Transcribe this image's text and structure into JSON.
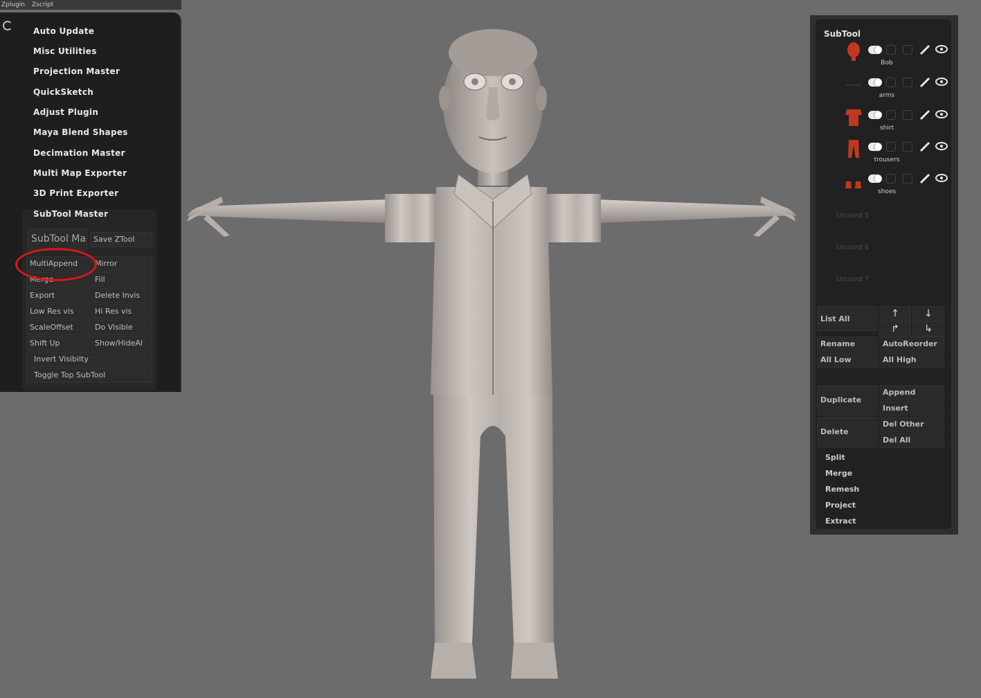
{
  "top_menu": [
    "Zplugin",
    "Zscript"
  ],
  "left_panel": {
    "plugins": [
      "Auto Update",
      "Misc Utilities",
      "Projection Master",
      "QuickSketch",
      "Adjust Plugin",
      "Maya Blend Shapes",
      "Decimation Master",
      "Multi Map Exporter",
      "3D Print Exporter",
      "SubTool Master"
    ],
    "subtool_master": {
      "header": "SubTool Master",
      "save_ztool": "Save ZTool",
      "multiappend": "MultiAppend",
      "mirror": "Mirror",
      "merge": "Merge",
      "fill": "Fill",
      "export": "Export",
      "delete_invis": "Delete Invis",
      "low_res_vis": "Low Res vis",
      "hi_res_vis": "Hi Res vis",
      "scale_offset": "ScaleOffset",
      "do_visible": "Do Visible",
      "shift_up": "Shift Up",
      "show_hide_all": "Show/HideAl",
      "invert_visibility": "Invert Visibilty",
      "toggle_top_subtool": "Toggle Top SubTool"
    }
  },
  "right_panel": {
    "title": "SubTool",
    "subtools": [
      {
        "name": "Bob",
        "color": "#c0391f"
      },
      {
        "name": "arms",
        "color": "#6a3a2a"
      },
      {
        "name": "shirt",
        "color": "#c0391f"
      },
      {
        "name": "trousers",
        "color": "#c0391f"
      },
      {
        "name": "shoes",
        "color": "#c0391f"
      }
    ],
    "unused": [
      "Unused 5",
      "Unused 6",
      "Unused 7"
    ],
    "list_all": "List All",
    "rename": "Rename",
    "auto_reorder": "AutoReorder",
    "all_low": "All Low",
    "all_high": "All High",
    "duplicate": "Duplicate",
    "append": "Append",
    "insert": "Insert",
    "delete": "Delete",
    "del_other": "Del Other",
    "del_all": "Del All",
    "actions": [
      "Split",
      "Merge",
      "Remesh",
      "Project",
      "Extract"
    ]
  },
  "accent_colors": {
    "annotation_circle": "#e0141b",
    "thumb_red": "#c0391f"
  }
}
